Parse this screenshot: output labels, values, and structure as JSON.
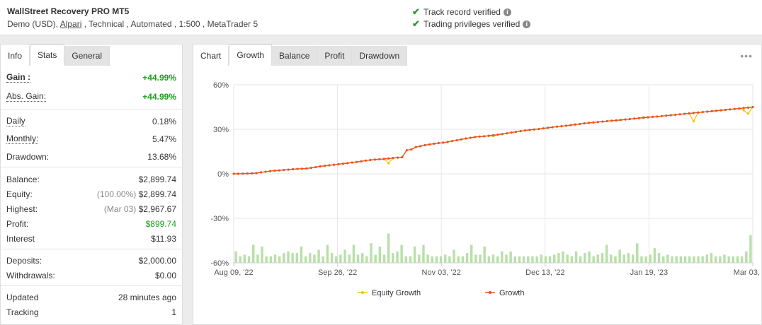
{
  "header": {
    "title": "WallStreet Recovery PRO MT5",
    "account_prefix": "Demo (USD), ",
    "broker": "Alpari",
    "account_suffix": " , Technical , Automated , 1:500 , MetaTrader 5",
    "verifications": [
      "Track record verified",
      "Trading privileges verified"
    ]
  },
  "left_tabs": [
    "Info",
    "Stats",
    "General"
  ],
  "stats": {
    "gain_label": "Gain :",
    "gain_value": "+44.99%",
    "abs_gain_label": "Abs. Gain:",
    "abs_gain_value": "+44.99%",
    "daily_label": "Daily",
    "daily_value": "0.18%",
    "monthly_label": "Monthly:",
    "monthly_value": "5.47%",
    "drawdown_label": "Drawdown:",
    "drawdown_value": "13.68%",
    "balance_label": "Balance:",
    "balance_value": "$2,899.74",
    "equity_label": "Equity:",
    "equity_pct": "(100.00%)",
    "equity_value": "$2,899.74",
    "highest_label": "Highest:",
    "highest_date": "(Mar 03)",
    "highest_value": "$2,967.67",
    "profit_label": "Profit:",
    "profit_value": "$899.74",
    "interest_label": "Interest",
    "interest_value": "$11.93",
    "deposits_label": "Deposits:",
    "deposits_value": "$2,000.00",
    "withdrawals_label": "Withdrawals:",
    "withdrawals_value": "$0.00",
    "updated_label": "Updated",
    "updated_value": "28 minutes ago",
    "tracking_label": "Tracking",
    "tracking_value": "1"
  },
  "chart_tabs": [
    "Chart",
    "Growth",
    "Balance",
    "Profit",
    "Drawdown"
  ],
  "more_icon": "more-options-icon",
  "chart_data": {
    "type": "line",
    "ylim": [
      -60,
      60
    ],
    "yticks": [
      60,
      30,
      0,
      -30,
      -60
    ],
    "ytick_labels": [
      "60%",
      "30%",
      "0%",
      "-30%",
      "-60%"
    ],
    "xtick_labels": [
      "Aug 09, '22",
      "Sep 26, '22",
      "Nov 03, '22",
      "Dec 13, '22",
      "Jan 19, '23",
      "Mar 03, '23"
    ],
    "legend": [
      "Equity Growth",
      "Growth"
    ],
    "colors": {
      "equity": "#f5c400",
      "growth": "#e8541e",
      "bars": "#b7e0a8",
      "grid": "#e6e6e6"
    },
    "growth": [
      0.0,
      0.0,
      0.1,
      0.2,
      0.3,
      0.5,
      1.0,
      1.4,
      1.8,
      2.1,
      2.3,
      2.6,
      2.8,
      3.1,
      3.3,
      3.4,
      3.6,
      4.0,
      4.5,
      5.0,
      5.4,
      5.7,
      6.1,
      6.5,
      6.8,
      7.2,
      7.6,
      8.0,
      8.4,
      8.9,
      9.3,
      9.6,
      9.8,
      10.0,
      10.3,
      10.6,
      10.9,
      11.2,
      15.9,
      16.4,
      18.0,
      18.6,
      19.3,
      19.8,
      20.3,
      20.7,
      21.0,
      21.5,
      22.1,
      22.6,
      23.2,
      23.8,
      24.3,
      24.8,
      25.1,
      25.3,
      25.6,
      26.0,
      26.4,
      26.8,
      27.3,
      27.8,
      28.3,
      28.8,
      29.2,
      29.6,
      29.9,
      30.2,
      30.6,
      31.0,
      31.4,
      31.8,
      32.1,
      32.4,
      32.8,
      33.2,
      33.6,
      34.0,
      34.3,
      34.6,
      34.9,
      35.2,
      35.5,
      35.8,
      36.0,
      36.3,
      36.6,
      36.9,
      37.2,
      37.5,
      37.8,
      38.1,
      38.4,
      38.6,
      38.9,
      39.2,
      39.5,
      39.8,
      40.1,
      40.4,
      40.7,
      41.0,
      41.3,
      41.6,
      41.9,
      42.2,
      42.5,
      42.8,
      43.1,
      43.4,
      43.7,
      44.0,
      44.3,
      44.6,
      44.99
    ],
    "equity_dips": [
      [
        34,
        7.1
      ],
      [
        57,
        25.4
      ],
      [
        75,
        33.2
      ],
      [
        90,
        38.1
      ],
      [
        101,
        35.4
      ],
      [
        112,
        42.8
      ],
      [
        113,
        40.6
      ]
    ],
    "bars": [
      7,
      4,
      5,
      4,
      11,
      5,
      10,
      4,
      4,
      5,
      4,
      6,
      7,
      6,
      6,
      10,
      4,
      6,
      5,
      8,
      4,
      11,
      6,
      4,
      5,
      8,
      5,
      11,
      5,
      6,
      4,
      12,
      5,
      10,
      5,
      18,
      6,
      7,
      11,
      4,
      4,
      10,
      5,
      11,
      5,
      4,
      4,
      4,
      5,
      4,
      8,
      4,
      4,
      6,
      11,
      5,
      5,
      10,
      4,
      5,
      4,
      7,
      5,
      7,
      4,
      4,
      4,
      4,
      4,
      4,
      5,
      4,
      4,
      5,
      6,
      7,
      5,
      4,
      7,
      4,
      6,
      7,
      4,
      5,
      6,
      11,
      5,
      4,
      8,
      5,
      6,
      5,
      12,
      4,
      4,
      5,
      9,
      6,
      4,
      5,
      4,
      4,
      4,
      4,
      4,
      4,
      4,
      4,
      5,
      6,
      4,
      4,
      5,
      4,
      4,
      4,
      4,
      7,
      17
    ]
  }
}
